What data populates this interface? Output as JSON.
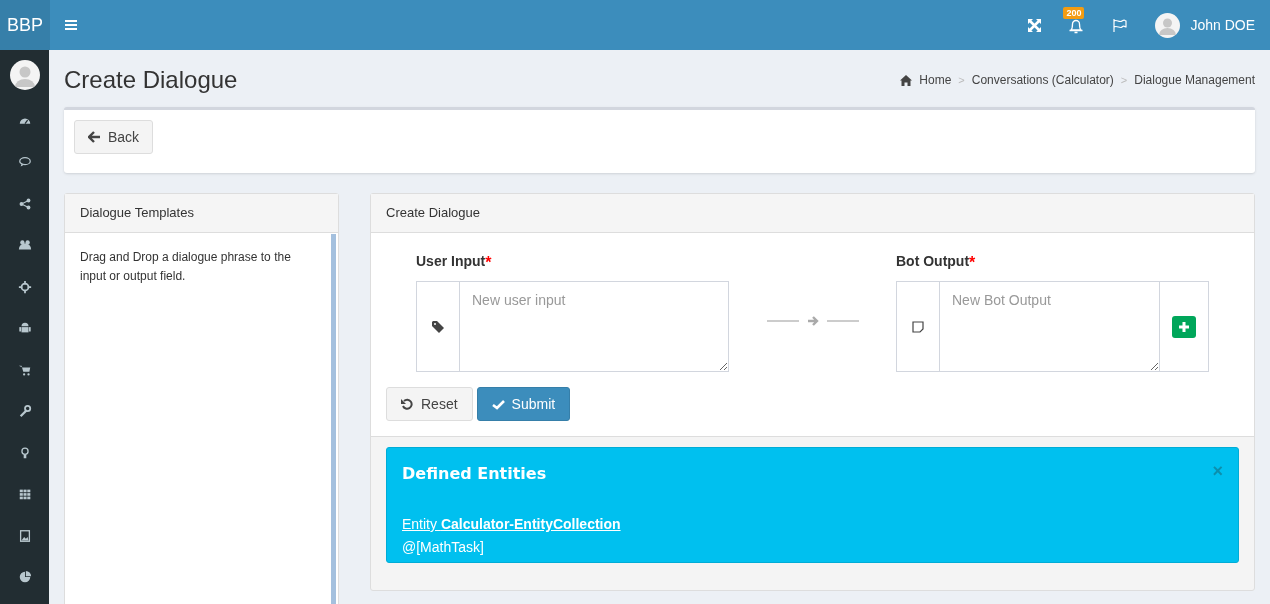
{
  "header": {
    "logo": "BBP",
    "notifications_count": "200",
    "user_name": "John DOE"
  },
  "page": {
    "title": "Create Dialogue",
    "breadcrumbs": [
      "Home",
      "Conversations (Calculator)",
      "Dialogue Management"
    ],
    "separator": ">"
  },
  "back_button": "Back",
  "templates_panel": {
    "title": "Dialogue Templates",
    "text": "Drag and Drop a dialogue phrase to the input or output field."
  },
  "create_panel": {
    "title": "Create Dialogue",
    "user_input": {
      "label": "User Input",
      "required_mark": "*",
      "placeholder": "New user input"
    },
    "bot_output": {
      "label": "Bot Output",
      "required_mark": "*",
      "placeholder": "New Bot Output"
    },
    "buttons": [
      "Reset",
      "Submit"
    ],
    "entities": {
      "title": "Defined Entities",
      "close": "×",
      "link": "Entity **Calculator-EntityCollection**",
      "text": "@[MathTask]"
    }
  }
}
